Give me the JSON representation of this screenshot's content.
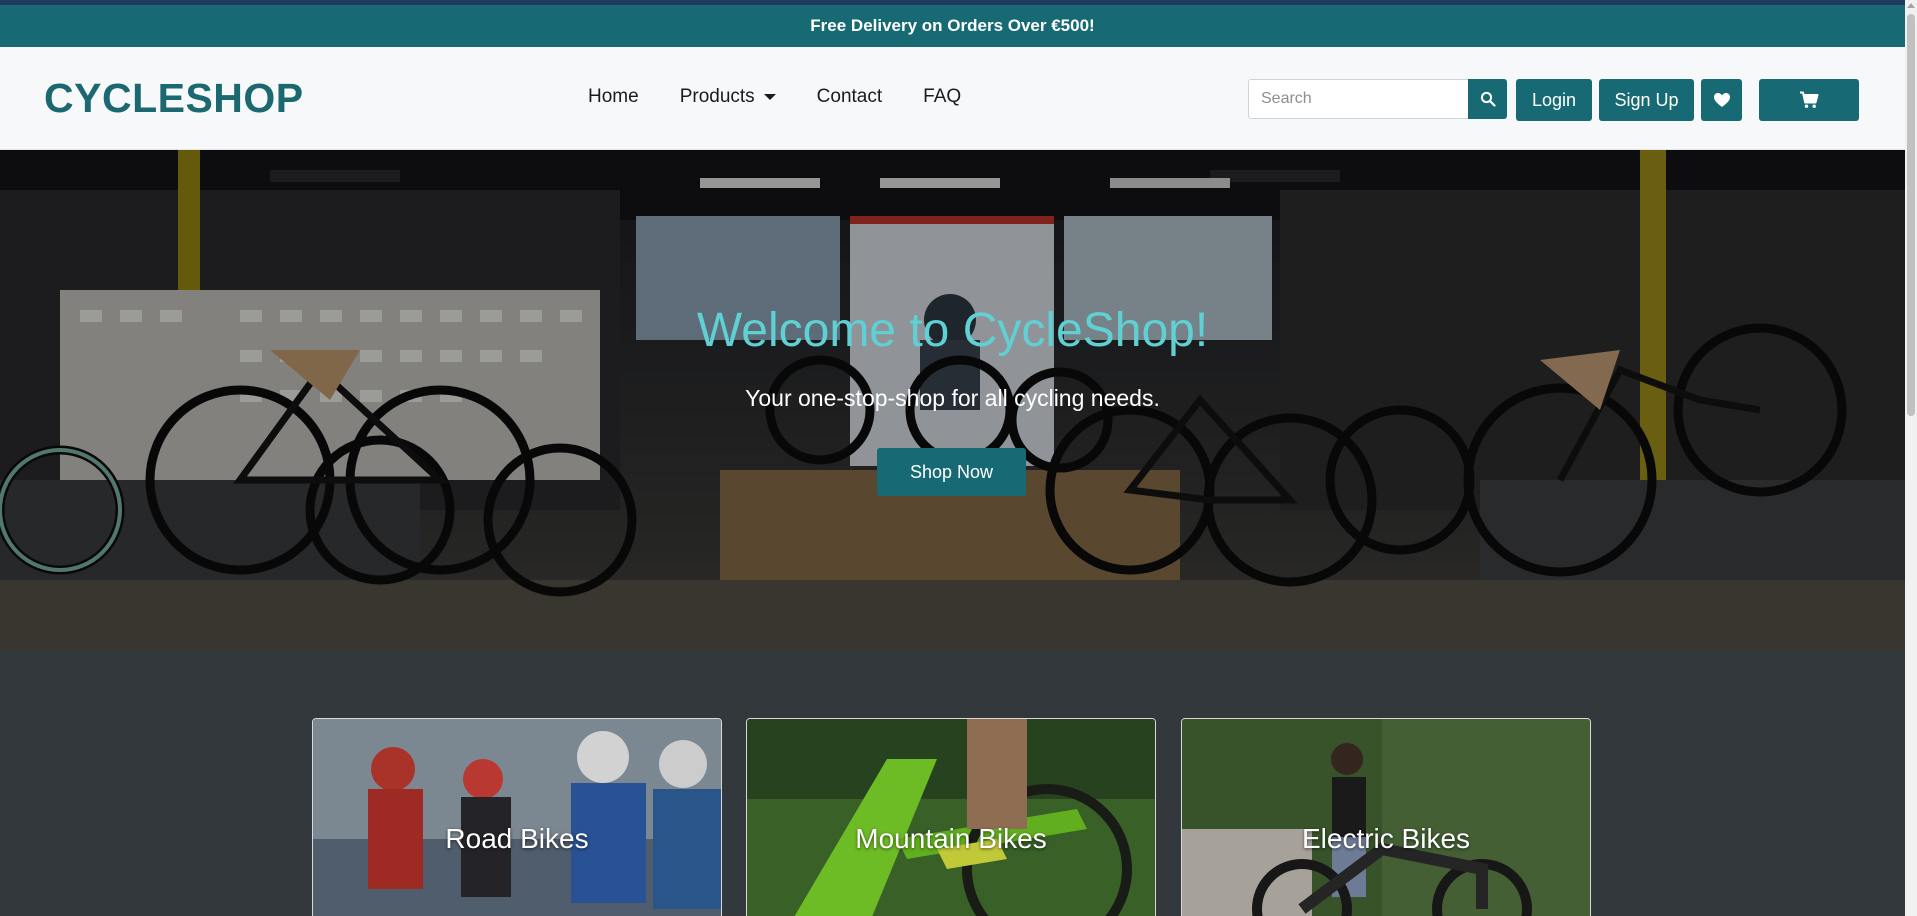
{
  "promo": {
    "text": "Free Delivery on Orders Over €500!"
  },
  "brand": {
    "name": "CYCLESHOP"
  },
  "nav": {
    "items": [
      {
        "label": "Home"
      },
      {
        "label": "Products",
        "dropdown": true
      },
      {
        "label": "Contact"
      },
      {
        "label": "FAQ"
      }
    ]
  },
  "search": {
    "placeholder": "Search",
    "value": "",
    "icon": "search-icon"
  },
  "actions": {
    "login_label": "Login",
    "signup_label": "Sign Up",
    "wishlist_icon": "heart-icon",
    "cart_icon": "cart-icon"
  },
  "hero": {
    "title": "Welcome to CycleShop!",
    "subtitle": "Your one-stop-shop for all cycling needs.",
    "cta_label": "Shop Now"
  },
  "categories": [
    {
      "label": "Road Bikes"
    },
    {
      "label": "Mountain Bikes"
    },
    {
      "label": "Electric Bikes"
    }
  ],
  "colors": {
    "accent": "#176a73",
    "brand": "#1b6870",
    "hero_title": "#5fd0d3",
    "page_bg": "#33383c"
  }
}
